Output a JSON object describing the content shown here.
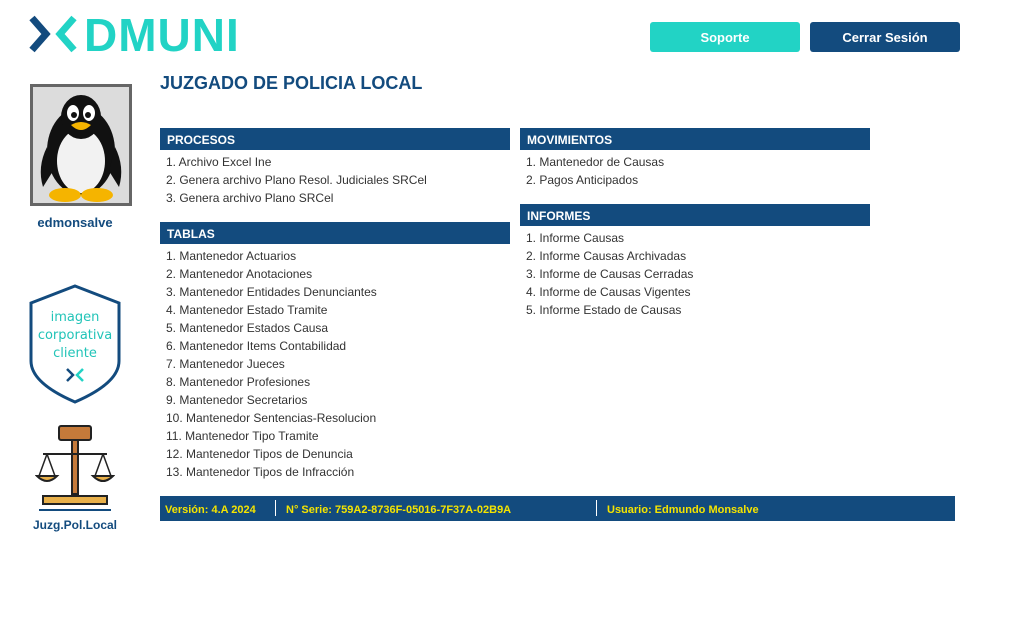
{
  "brand": {
    "logo_text": "DMUNI",
    "primary_color": "#134b7e",
    "accent_color": "#22d3c5"
  },
  "header": {
    "support_label": "Soporte",
    "logout_label": "Cerrar Sesión"
  },
  "user": {
    "username": "edmonsalve",
    "avatar_icon": "penguin-icon"
  },
  "sidebar": {
    "corporate_image": {
      "line1": "imagen",
      "line2": "corporativa",
      "line3": "cliente"
    },
    "module_label": "Juzg.Pol.Local"
  },
  "page": {
    "title": "JUZGADO DE POLICIA LOCAL"
  },
  "sections": {
    "procesos": {
      "title": "PROCESOS",
      "items": [
        "1. Archivo Excel Ine",
        "2. Genera archivo Plano Resol. Judiciales SRCel",
        "3. Genera archivo Plano SRCel"
      ]
    },
    "tablas": {
      "title": "TABLAS",
      "items": [
        "1. Mantenedor Actuarios",
        "2. Mantenedor Anotaciones",
        "3. Mantenedor Entidades Denunciantes",
        "4. Mantenedor Estado Tramite",
        "5. Mantenedor Estados Causa",
        "6. Mantenedor Items Contabilidad",
        "7. Mantenedor Jueces",
        "8. Mantenedor Profesiones",
        "9. Mantenedor Secretarios",
        "10. Mantenedor Sentencias-Resolucion",
        "11. Mantenedor Tipo Tramite",
        "12. Mantenedor Tipos de Denuncia",
        "13. Mantenedor Tipos de Infracción"
      ]
    },
    "movimientos": {
      "title": "MOVIMIENTOS",
      "items": [
        "1. Mantenedor de Causas",
        "2. Pagos Anticipados"
      ]
    },
    "informes": {
      "title": "INFORMES",
      "items": [
        "1. Informe Causas",
        "2. Informe Causas Archivadas",
        "3. Informe de Causas Cerradas",
        "4. Informe de Causas Vigentes",
        "5. Informe Estado de Causas"
      ]
    }
  },
  "footer": {
    "version": "Versión: 4.A 2024",
    "serial": "N° Serie: 759A2-8736F-05016-7F37A-02B9A",
    "user": "Usuario: Edmundo Monsalve"
  }
}
